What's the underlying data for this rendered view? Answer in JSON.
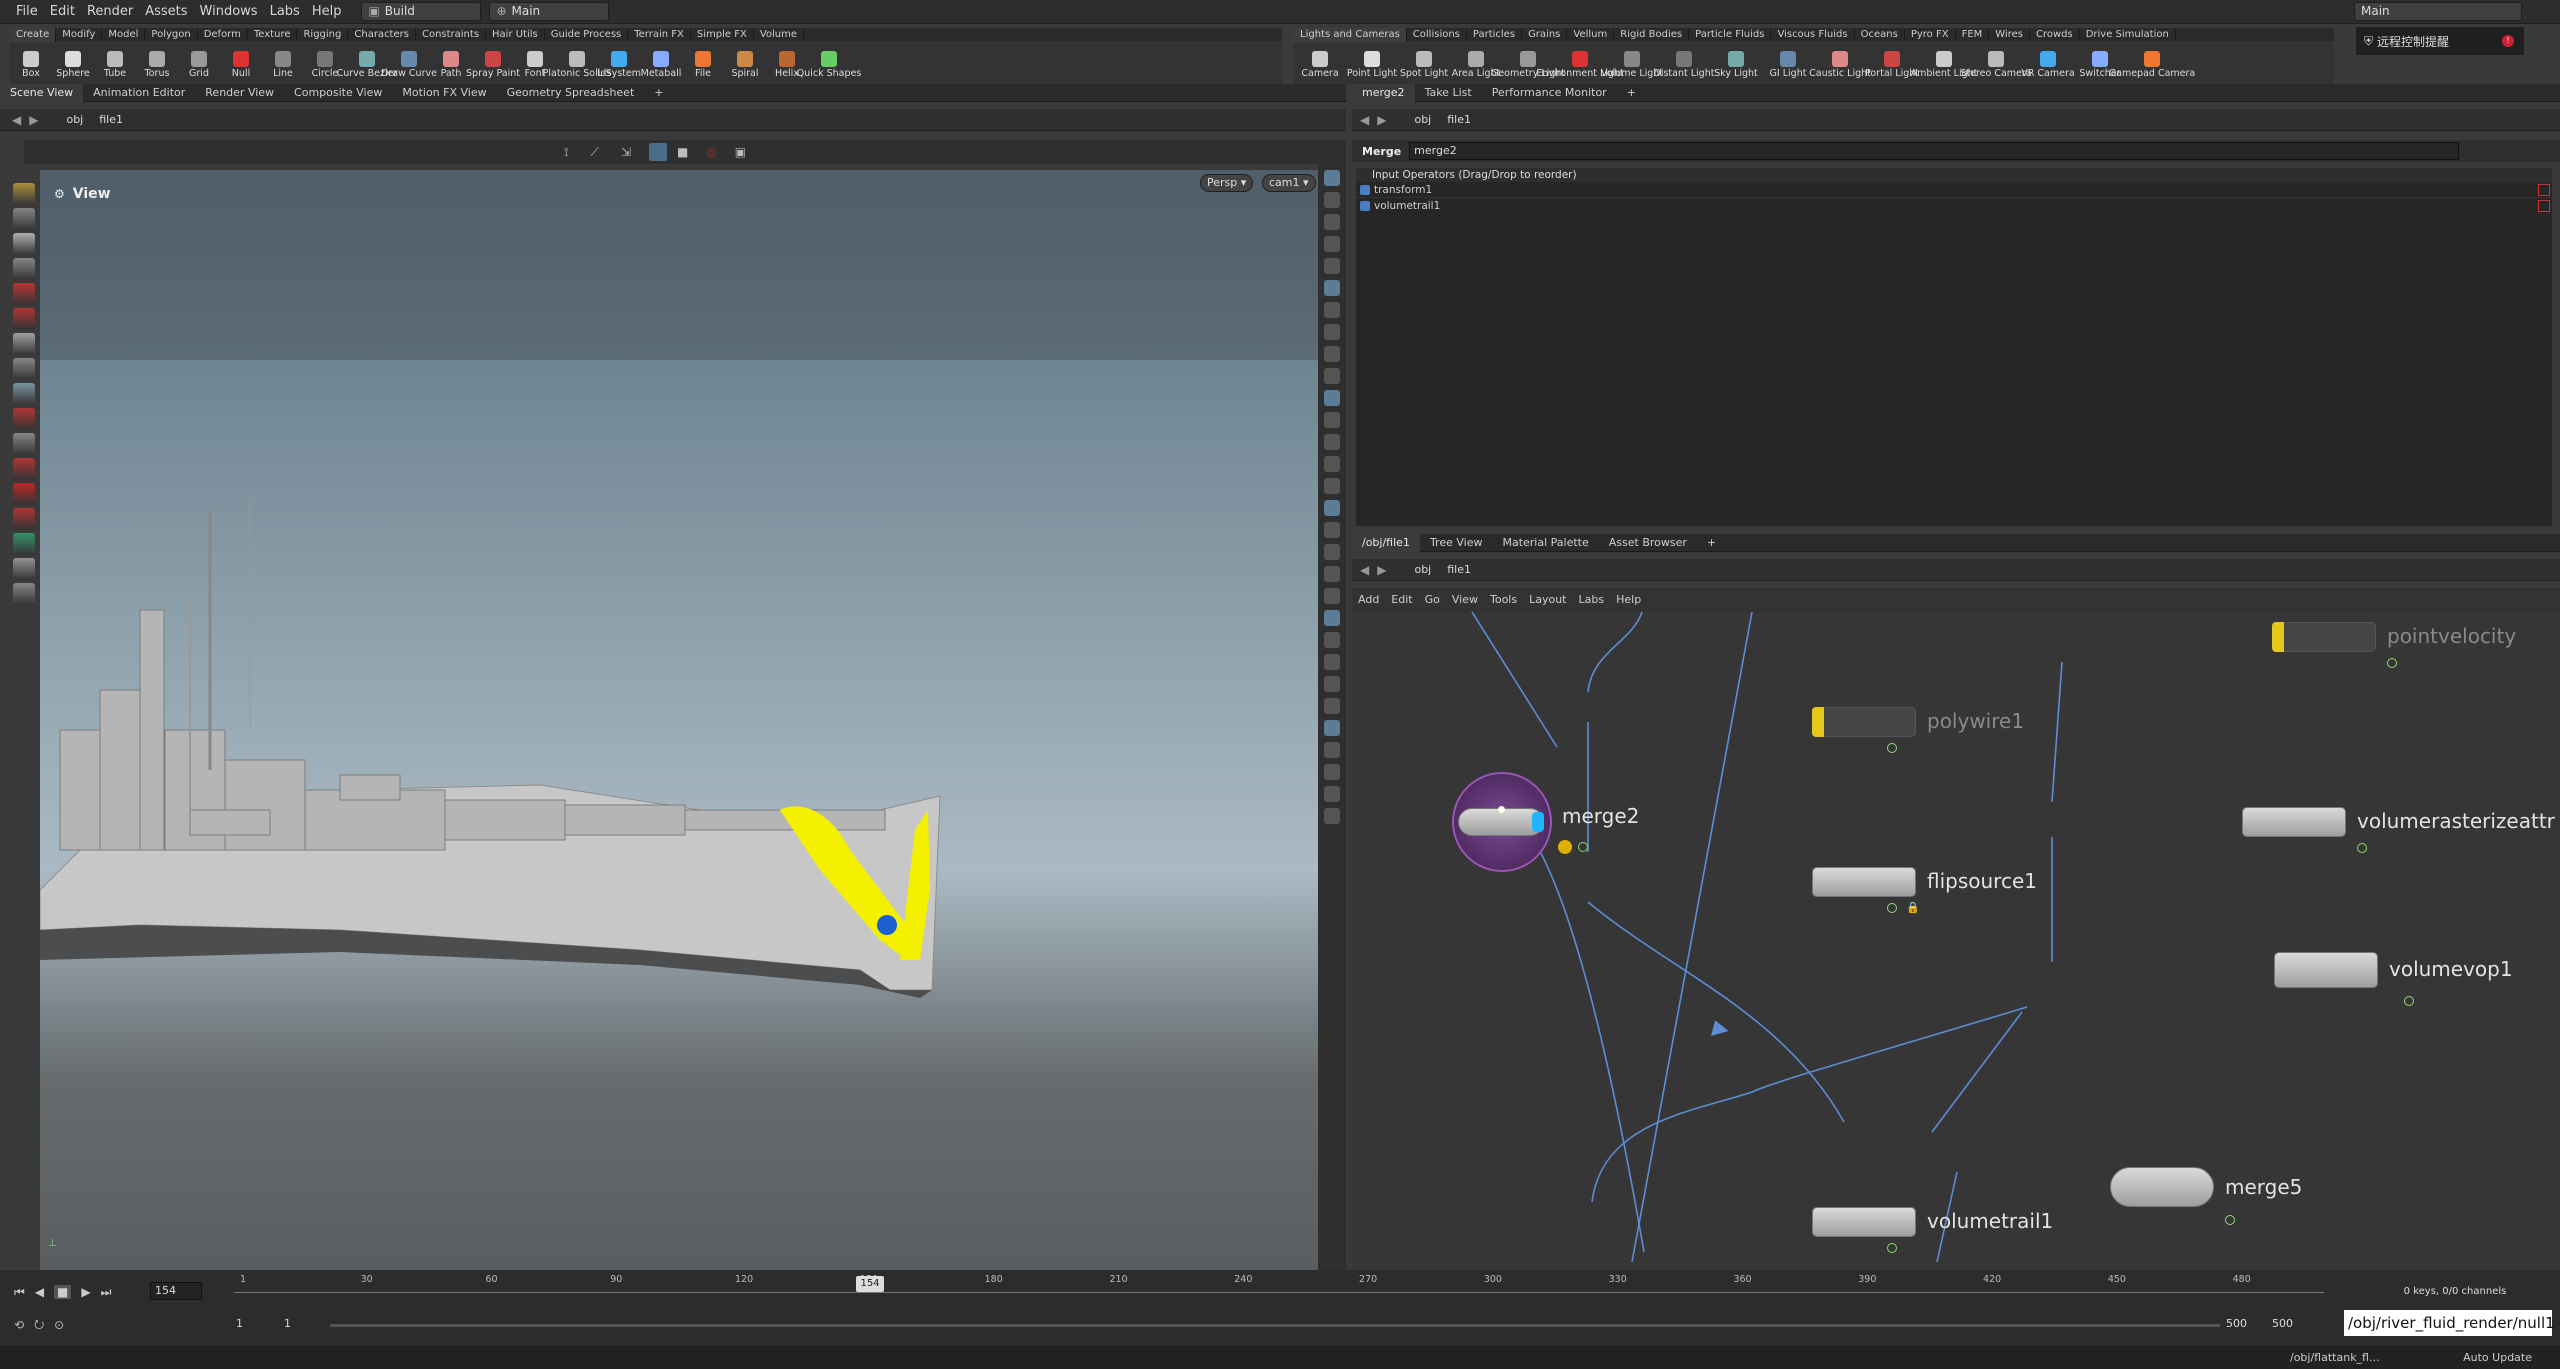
{
  "menu": {
    "items": [
      "File",
      "Edit",
      "Render",
      "Assets",
      "Windows",
      "Labs",
      "Help"
    ],
    "desktop": "Build",
    "context": "Main"
  },
  "right_top": {
    "context": "Main",
    "notice": "远程控制提醒"
  },
  "left_shelf": {
    "tabs": [
      "Create",
      "Modify",
      "Model",
      "Polygon",
      "Deform",
      "Texture",
      "Rigging",
      "Characters",
      "Constraints",
      "Hair Utils",
      "Guide Process",
      "Terrain FX",
      "Simple FX",
      "Volume"
    ],
    "tools": [
      "Box",
      "Sphere",
      "Tube",
      "Torus",
      "Grid",
      "Null",
      "Line",
      "Circle",
      "Curve Bezier",
      "Draw Curve",
      "Path",
      "Spray Paint",
      "Font",
      "Platonic Solids",
      "L-System",
      "Metaball",
      "File",
      "Spiral",
      "Helix",
      "Quick Shapes"
    ]
  },
  "right_shelf": {
    "tabs": [
      "Lights and Cameras",
      "Collisions",
      "Particles",
      "Grains",
      "Vellum",
      "Rigid Bodies",
      "Particle Fluids",
      "Viscous Fluids",
      "Oceans",
      "Pyro FX",
      "FEM",
      "Wires",
      "Crowds",
      "Drive Simulation"
    ],
    "tools": [
      "Camera",
      "Point Light",
      "Spot Light",
      "Area Light",
      "Geometry Light",
      "Environment Light",
      "Volume Light",
      "Distant Light",
      "Sky Light",
      "GI Light",
      "Caustic Light",
      "Portal Light",
      "Ambient Light",
      "Stereo Camera",
      "VR Camera",
      "Switcher",
      "Gamepad Camera"
    ]
  },
  "left_pane": {
    "tabs": [
      "Scene View",
      "Animation Editor",
      "Render View",
      "Composite View",
      "Motion FX View",
      "Geometry Spreadsheet"
    ],
    "path": [
      "obj",
      "file1"
    ],
    "viewport": {
      "title": "View",
      "persp": "Persp",
      "cam": "cam1"
    }
  },
  "param_pane": {
    "tabs": [
      "merge2",
      "Take List",
      "Performance Monitor"
    ],
    "path": [
      "obj",
      "file1"
    ],
    "node_type": "Merge",
    "node_name": "merge2",
    "list_header": "Input Operators (Drag/Drop to reorder)",
    "inputs": [
      "transform1",
      "volumetrail1"
    ]
  },
  "network_pane": {
    "tabs": [
      "/obj/file1",
      "Tree View",
      "Material Palette",
      "Asset Browser"
    ],
    "path": [
      "obj",
      "file1"
    ],
    "menu": [
      "Add",
      "Edit",
      "Go",
      "View",
      "Tools",
      "Layout",
      "Labs",
      "Help"
    ],
    "nodes": {
      "merge2": "merge2",
      "polywire1": "polywire1",
      "flipsource1": "flipsource1",
      "pointvelocity": "pointvelocity",
      "volumerasterize": "volumerasterizeattr",
      "volumevop1": "volumevop1",
      "merge5": "merge5",
      "volumetrail1": "volumetrail1"
    }
  },
  "timeline": {
    "current_frame": "154",
    "marker": "154",
    "start": "1",
    "start2": "1",
    "end": "500",
    "end2": "500",
    "keys": "0 keys, 0/0 channels",
    "auto_update": "Auto Update",
    "ticks": [
      "1",
      "30",
      "60",
      "90",
      "120",
      "150",
      "180",
      "210",
      "240",
      "270",
      "300",
      "330",
      "360",
      "390",
      "420",
      "450",
      "480"
    ]
  },
  "status": {
    "tooltip": "/obj/river_fluid_render/null1",
    "path": "/obj/flattank_fl..."
  }
}
